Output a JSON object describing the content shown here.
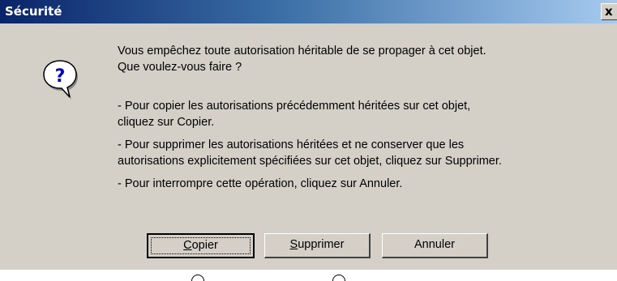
{
  "window": {
    "title": "Sécurité",
    "close_glyph": "x"
  },
  "icon": {
    "name": "question-icon",
    "glyph": "?"
  },
  "message": {
    "line1": "Vous empêchez toute autorisation héritable de se propager à cet objet.",
    "line2": "Que voulez-vous faire ?",
    "copy_line1": "- Pour copier les autorisations précédemment héritées sur cet objet,",
    "copy_line2": "cliquez sur Copier.",
    "delete_line1": "- Pour supprimer les autorisations héritées et ne conserver que les",
    "delete_line2": "autorisations explicitement spécifiées sur cet objet, cliquez sur Supprimer.",
    "cancel_line": "- Pour interrompre cette opération, cliquez sur Annuler."
  },
  "buttons": {
    "copy_accel": "C",
    "copy_rest": "opier",
    "delete_accel": "S",
    "delete_rest": "upprimer",
    "cancel": "Annuler"
  },
  "colors": {
    "dialog_bg": "#d4d0c8",
    "titlebar_start": "#0a246a",
    "titlebar_end": "#a6caf0"
  }
}
